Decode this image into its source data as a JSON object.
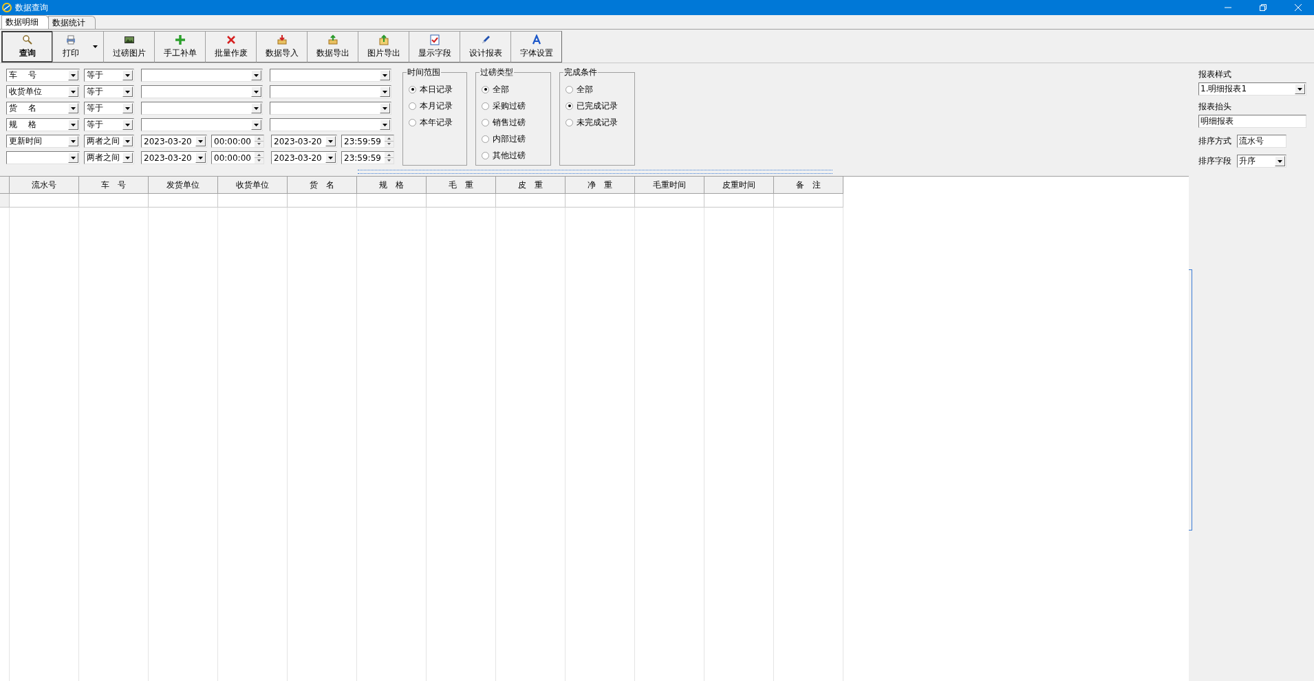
{
  "window": {
    "title": "数据查询"
  },
  "tabs": [
    {
      "label": "数据明细",
      "selected": true
    },
    {
      "label": "数据统计",
      "selected": false
    }
  ],
  "toolbar": [
    {
      "kind": "search",
      "label": "查询",
      "default": true,
      "dropdown": false
    },
    {
      "kind": "print",
      "label": "打印",
      "default": false,
      "dropdown": true
    },
    {
      "kind": "picture",
      "label": "过磅图片",
      "default": false,
      "dropdown": false
    },
    {
      "kind": "add",
      "label": "手工补单",
      "default": false,
      "dropdown": false
    },
    {
      "kind": "delete",
      "label": "批量作废",
      "default": false,
      "dropdown": false
    },
    {
      "kind": "import",
      "label": "数据导入",
      "default": false,
      "dropdown": false
    },
    {
      "kind": "export",
      "label": "数据导出",
      "default": false,
      "dropdown": false
    },
    {
      "kind": "upload",
      "label": "图片导出",
      "default": false,
      "dropdown": false
    },
    {
      "kind": "fields",
      "label": "显示字段",
      "default": false,
      "dropdown": false
    },
    {
      "kind": "pen",
      "label": "设计报表",
      "default": false,
      "dropdown": false
    },
    {
      "kind": "font",
      "label": "字体设置",
      "default": false,
      "dropdown": false
    }
  ],
  "filters": [
    {
      "kind": "text",
      "field": "车　 号",
      "operator": "等于"
    },
    {
      "kind": "text",
      "field": "收货单位",
      "operator": "等于"
    },
    {
      "kind": "text",
      "field": "货　 名",
      "operator": "等于"
    },
    {
      "kind": "text",
      "field": "规　 格",
      "operator": "等于"
    },
    {
      "kind": "range",
      "field": "更新时间",
      "operator": "两者之间",
      "from_date": "2023-03-20",
      "from_time": "00:00:00",
      "to_date": "2023-03-20",
      "to_time": "23:59:59"
    },
    {
      "kind": "range",
      "operator": "两者之间",
      "from_date": "2023-03-20",
      "from_time": "00:00:00",
      "to_date": "2023-03-20",
      "to_time": "23:59:59"
    }
  ],
  "groups": [
    {
      "title": "时间范围",
      "options": [
        {
          "label": "本日记录",
          "selected": true
        },
        {
          "label": "本月记录",
          "selected": false
        },
        {
          "label": "本年记录",
          "selected": false
        }
      ]
    },
    {
      "title": "过磅类型",
      "options": [
        {
          "label": "全部",
          "selected": true
        },
        {
          "label": "采购过磅",
          "selected": false
        },
        {
          "label": "销售过磅",
          "selected": false
        },
        {
          "label": "内部过磅",
          "selected": false
        },
        {
          "label": "其他过磅",
          "selected": false
        }
      ]
    },
    {
      "title": "完成条件",
      "options": [
        {
          "label": "全部",
          "selected": false
        },
        {
          "label": "已完成记录",
          "selected": true
        },
        {
          "label": "未完成记录",
          "selected": false
        }
      ]
    }
  ],
  "table": {
    "columns": [
      "流水号",
      "车　号",
      "发货单位",
      "收货单位",
      "货　名",
      "规　格",
      "毛　重",
      "皮　重",
      "净　重",
      "毛重时间",
      "皮重时间",
      "备　注"
    ]
  },
  "side_panel": {
    "report_style_label": "报表样式",
    "report_style": "1.明细报表1",
    "report_header_label": "报表抬头",
    "report_header": "明细报表",
    "sort_method_label": "排序方式",
    "sort_method": "流水号",
    "sort_field_label": "排序字段",
    "sort_field": "升序"
  }
}
